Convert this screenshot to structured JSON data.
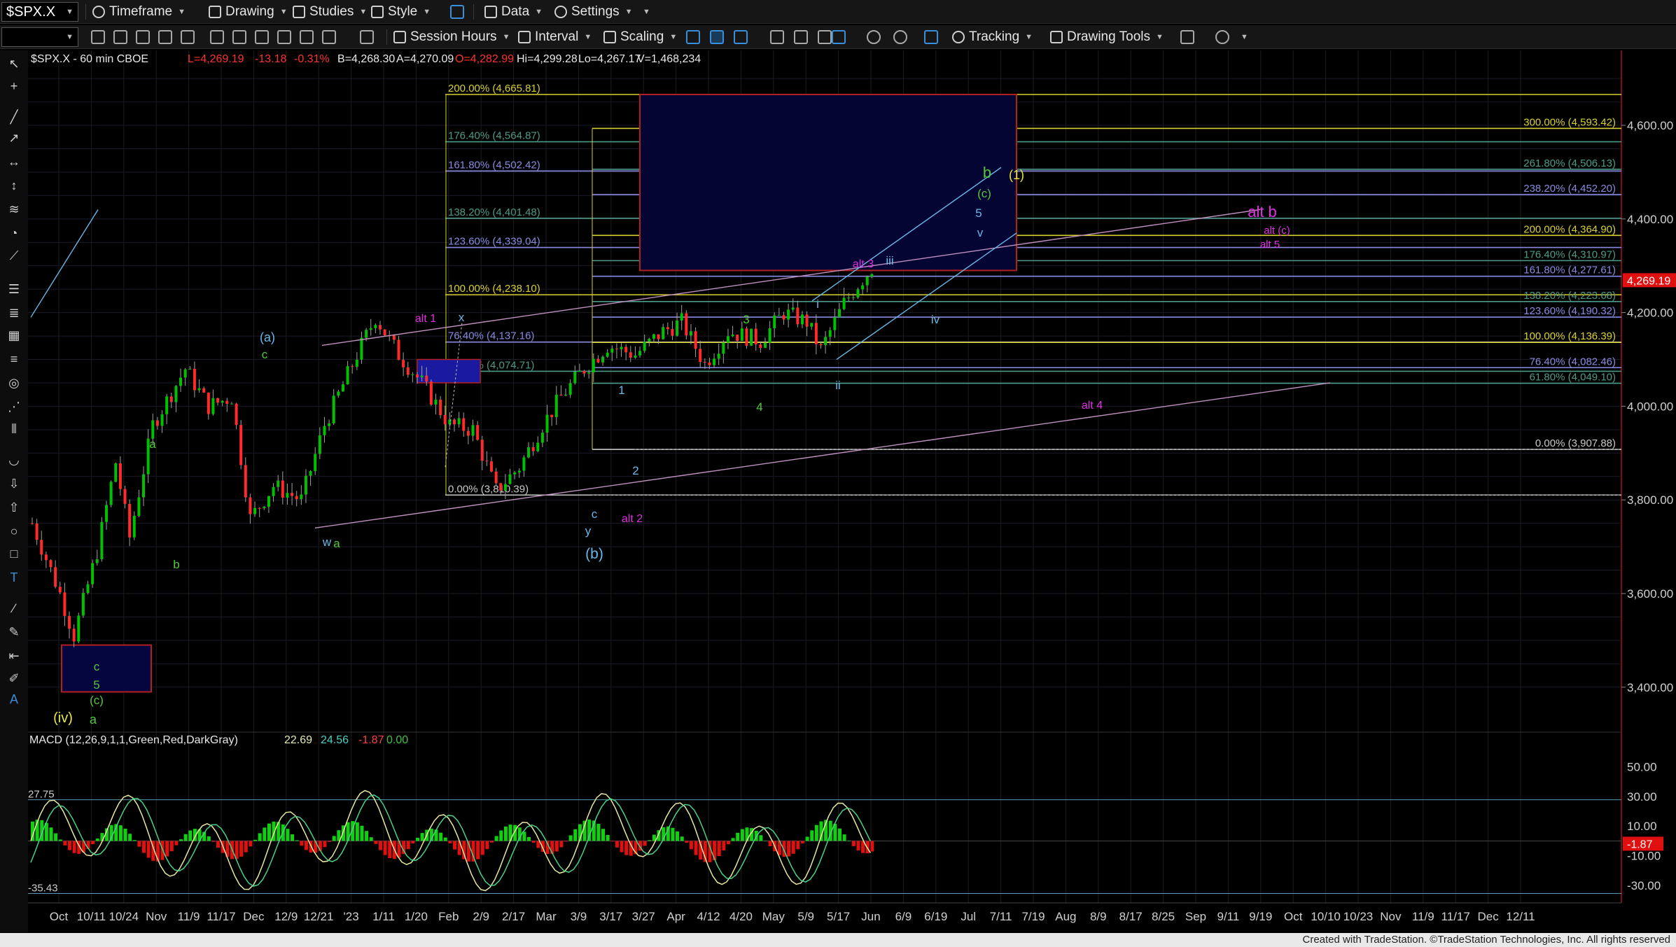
{
  "toolbar": {
    "symbol": "$SPX.X",
    "menus": [
      "Timeframe",
      "Drawing",
      "Studies",
      "Style",
      "Data",
      "Settings"
    ],
    "row2": [
      "Session Hours",
      "Interval",
      "Scaling",
      "Tracking",
      "Drawing Tools"
    ]
  },
  "header": {
    "title": "$SPX.X - 60 min  CBOE",
    "last": "L=4,269.19",
    "change": "-13.18",
    "pct": "-0.31%",
    "bid": "B=4,268.30",
    "ask": "A=4,270.09",
    "open": "O=4,282.99",
    "high": "Hi=4,299.28",
    "low": "Lo=4,267.17",
    "volume": "V=1,468,234"
  },
  "colors": {
    "up": "#00c000",
    "down": "#ff2a2a",
    "last_price_bg": "#e01010",
    "magenta": "#e030e0",
    "green": "#52c93a",
    "cyan": "#6ab8e8"
  },
  "chart_data": [
    {
      "type": "candlestick",
      "title": "$SPX.X - 60 min",
      "ylim": [
        3310,
        4760
      ],
      "y_ticks": [
        "4,600.00",
        "4,400.00",
        "4,200.00",
        "4,000.00",
        "3,800.00",
        "3,600.00",
        "3,400.00"
      ],
      "x_ticks": [
        "Oct",
        "10/11",
        "10/24",
        "Nov",
        "11/9",
        "11/17",
        "Dec",
        "12/9",
        "12/21",
        "'23",
        "1/11",
        "1/20",
        "Feb",
        "2/9",
        "2/17",
        "Mar",
        "3/9",
        "3/17",
        "3/27",
        "Apr",
        "4/12",
        "4/20",
        "May",
        "5/9",
        "5/17",
        "Jun",
        "6/9",
        "6/19",
        "Jul",
        "7/11",
        "7/19",
        "Aug",
        "8/9",
        "8/17",
        "8/25",
        "Sep",
        "9/11",
        "9/19",
        "Oct",
        "10/10",
        "10/23",
        "Nov",
        "11/9",
        "11/17",
        "Dec",
        "12/11"
      ],
      "last_price": "4,269.19",
      "price_path": [
        [
          0,
          3750
        ],
        [
          6,
          3600
        ],
        [
          9,
          3510
        ],
        [
          14,
          3690
        ],
        [
          18,
          3880
        ],
        [
          21,
          3720
        ],
        [
          26,
          3960
        ],
        [
          33,
          4080
        ],
        [
          38,
          4000
        ],
        [
          43,
          4020
        ],
        [
          47,
          3760
        ],
        [
          52,
          3830
        ],
        [
          58,
          3800
        ],
        [
          63,
          3960
        ],
        [
          70,
          4110
        ],
        [
          74,
          4190
        ],
        [
          79,
          4110
        ],
        [
          84,
          4050
        ],
        [
          90,
          3960
        ],
        [
          95,
          3950
        ],
        [
          100,
          3820
        ],
        [
          105,
          3870
        ],
        [
          110,
          3960
        ],
        [
          114,
          4020
        ],
        [
          119,
          4080
        ],
        [
          124,
          4130
        ],
        [
          130,
          4110
        ],
        [
          136,
          4160
        ],
        [
          140,
          4180
        ],
        [
          145,
          4090
        ],
        [
          150,
          4160
        ],
        [
          157,
          4140
        ],
        [
          162,
          4200
        ],
        [
          167,
          4180
        ],
        [
          170,
          4120
        ],
        [
          175,
          4220
        ],
        [
          178,
          4260
        ],
        [
          181,
          4295
        ]
      ],
      "fib_levels": [
        {
          "label": "200.00% (4,665.81)",
          "value": 4665.81,
          "color": "#d8d030",
          "side": "left"
        },
        {
          "label": "176.40% (4,564.87)",
          "value": 4564.87,
          "color": "#4d9a8a",
          "side": "left"
        },
        {
          "label": "161.80% (4,502.42)",
          "value": 4502.42,
          "color": "#8a8ae0",
          "side": "left"
        },
        {
          "label": "138.20% (4,401.48)",
          "value": 4401.48,
          "color": "#4d9a8a",
          "side": "left"
        },
        {
          "label": "123.60% (4,339.04)",
          "value": 4339.04,
          "color": "#8a8ae0",
          "side": "left"
        },
        {
          "label": "100.00% (4,238.10)",
          "value": 4238.1,
          "color": "#d8d030",
          "side": "left"
        },
        {
          "label": "76.40% (4,137.16)",
          "value": 4137.16,
          "color": "#8a8ae0",
          "side": "left"
        },
        {
          "label": "61.80% (4,074.71)",
          "value": 4074.71,
          "color": "#4d9a8a",
          "side": "left"
        },
        {
          "label": "0.00% (3,810.39)",
          "value": 3810.39,
          "color": "#c8c8c8",
          "side": "left"
        },
        {
          "label": "300.00% (4,593.42)",
          "value": 4593.42,
          "color": "#d8d030",
          "side": "right"
        },
        {
          "label": "261.80% (4,506.13)",
          "value": 4506.13,
          "color": "#4d9a8a",
          "side": "right"
        },
        {
          "label": "238.20% (4,452.20)",
          "value": 4452.2,
          "color": "#8a8ae0",
          "side": "right"
        },
        {
          "label": "200.00% (4,364.90)",
          "value": 4364.9,
          "color": "#d8d030",
          "side": "right"
        },
        {
          "label": "176.40% (4,310.97)",
          "value": 4310.97,
          "color": "#4d9a8a",
          "side": "right"
        },
        {
          "label": "161.80% (4,277.61)",
          "value": 4277.61,
          "color": "#8a8ae0",
          "side": "right"
        },
        {
          "label": "138.20% (4,223.68)",
          "value": 4223.68,
          "color": "#4d9a8a",
          "side": "right"
        },
        {
          "label": "123.60% (4,190.32)",
          "value": 4190.32,
          "color": "#8a8ae0",
          "side": "right"
        },
        {
          "label": "100.00% (4,136.39)",
          "value": 4136.39,
          "color": "#d8d030",
          "side": "right"
        },
        {
          "label": "76.40% (4,082.46)",
          "value": 4082.46,
          "color": "#8a8ae0",
          "side": "right"
        },
        {
          "label": "61.80% (4,049.10)",
          "value": 4049.1,
          "color": "#4d9a8a",
          "side": "right"
        },
        {
          "label": "0.00% (3,907.88)",
          "value": 3907.88,
          "color": "#c8c8c8",
          "side": "right"
        }
      ],
      "wave_labels": [
        {
          "t": "(iv)",
          "color": "#e8e840"
        },
        {
          "t": "a",
          "color": "#52c93a"
        },
        {
          "t": "(c)",
          "color": "#52c93a"
        },
        {
          "t": "5",
          "color": "#52c93a"
        },
        {
          "t": "c",
          "color": "#52c93a"
        },
        {
          "t": "a",
          "color": "#52c93a"
        },
        {
          "t": "b",
          "color": "#52c93a"
        },
        {
          "t": "(a)",
          "color": "#6ab8e8"
        },
        {
          "t": "c",
          "color": "#52c93a"
        },
        {
          "t": "w",
          "color": "#6ab8e8"
        },
        {
          "t": "a",
          "color": "#52c93a"
        },
        {
          "t": "alt 1",
          "color": "#e030e0"
        },
        {
          "t": "x",
          "color": "#6ab8e8"
        },
        {
          "t": "c",
          "color": "#6ab8e8"
        },
        {
          "t": "y",
          "color": "#6ab8e8"
        },
        {
          "t": "(b)",
          "color": "#6ab8e8"
        },
        {
          "t": "alt 2",
          "color": "#e030e0"
        },
        {
          "t": "1",
          "color": "#6ab8e8"
        },
        {
          "t": "2",
          "color": "#6ab8e8"
        },
        {
          "t": "3",
          "color": "#52c93a"
        },
        {
          "t": "4",
          "color": "#52c93a"
        },
        {
          "t": "i",
          "color": "#6ab8e8"
        },
        {
          "t": "ii",
          "color": "#6ab8e8"
        },
        {
          "t": "alt 3",
          "color": "#e030e0"
        },
        {
          "t": "iii",
          "color": "#6ab8e8"
        },
        {
          "t": "iv",
          "color": "#6ab8e8"
        },
        {
          "t": "v",
          "color": "#6ab8e8"
        },
        {
          "t": "5",
          "color": "#6ab8e8"
        },
        {
          "t": "(c)",
          "color": "#52c93a"
        },
        {
          "t": "b",
          "color": "#52c93a"
        },
        {
          "t": "(1)",
          "color": "#e8e840"
        },
        {
          "t": "alt 4",
          "color": "#e030e0"
        },
        {
          "t": "alt b",
          "color": "#e030e0"
        },
        {
          "t": "alt (c)",
          "color": "#e030e0"
        },
        {
          "t": "alt 5",
          "color": "#e030e0"
        }
      ]
    },
    {
      "type": "line",
      "title": "MACD (12,26,9,1,1,Green,Red,DarkGray)",
      "values_text": [
        "22.69",
        "24.56",
        "-1.87",
        "0.00"
      ],
      "ylim": [
        -38,
        62
      ],
      "y_ticks": [
        "50.00",
        "30.00",
        "10.00",
        "-10.00",
        "-30.00"
      ],
      "markers": [
        "27.75",
        "-35.43"
      ],
      "last_hist": "-1.87"
    }
  ],
  "footer": {
    "text": "Created with TradeStation. ©TradeStation Technologies, Inc. All rights reserved"
  }
}
